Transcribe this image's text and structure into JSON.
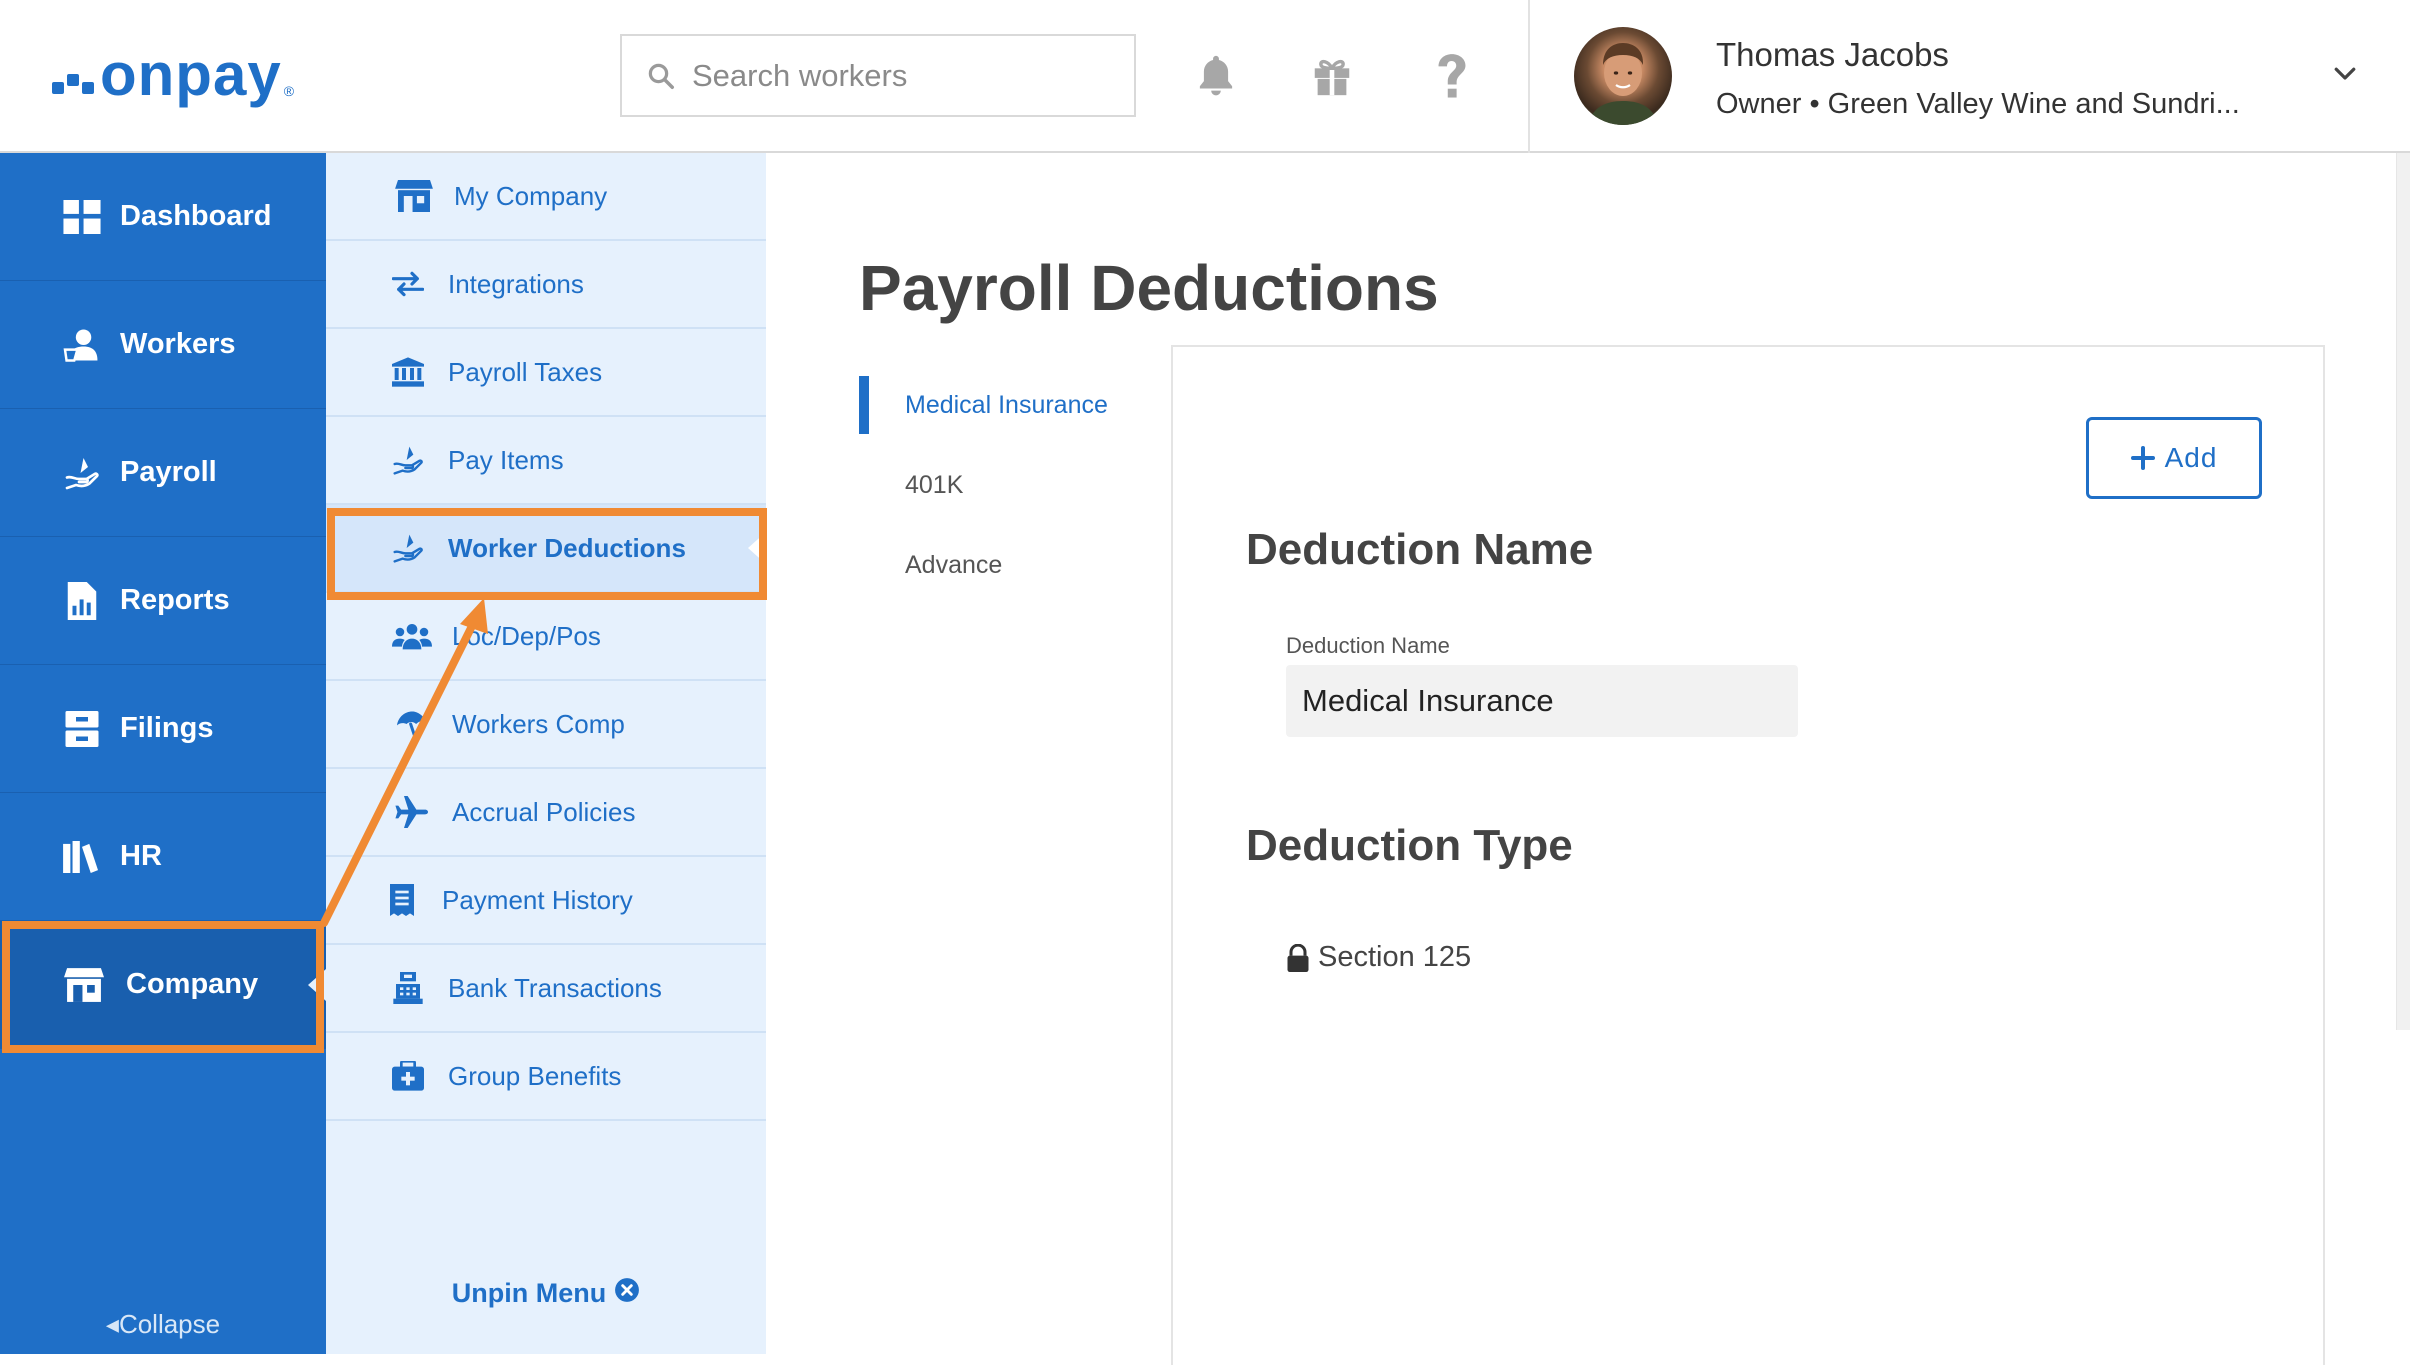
{
  "header": {
    "logo_text": "onpay",
    "logo_registered": "®",
    "search_placeholder": "Search workers",
    "icons": [
      "bell-icon",
      "gift-icon",
      "help-icon"
    ],
    "user": {
      "name": "Thomas Jacobs",
      "role": "Owner • Green Valley Wine and Sundri..."
    }
  },
  "sidebar": {
    "items": [
      {
        "label": "Dashboard",
        "icon": "dashboard-icon"
      },
      {
        "label": "Workers",
        "icon": "workers-icon"
      },
      {
        "label": "Payroll",
        "icon": "payroll-icon"
      },
      {
        "label": "Reports",
        "icon": "reports-icon"
      },
      {
        "label": "Filings",
        "icon": "filings-icon"
      },
      {
        "label": "HR",
        "icon": "hr-icon"
      },
      {
        "label": "Company",
        "icon": "company-icon",
        "active": true
      }
    ],
    "collapse_label": "Collapse"
  },
  "submenu": {
    "items": [
      {
        "label": "My Company",
        "icon": "store-icon"
      },
      {
        "label": "Integrations",
        "icon": "swap-icon"
      },
      {
        "label": "Payroll Taxes",
        "icon": "bank-icon"
      },
      {
        "label": "Pay Items",
        "icon": "hand-money-icon"
      },
      {
        "label": "Worker Deductions",
        "icon": "hand-money-icon",
        "active": true
      },
      {
        "label": "Loc/Dep/Pos",
        "icon": "people-group-icon"
      },
      {
        "label": "Workers Comp",
        "icon": "umbrella-icon"
      },
      {
        "label": "Accrual Policies",
        "icon": "plane-icon"
      },
      {
        "label": "Payment History",
        "icon": "receipt-icon"
      },
      {
        "label": "Bank Transactions",
        "icon": "register-icon"
      },
      {
        "label": "Group Benefits",
        "icon": "medical-kit-icon"
      }
    ],
    "unpin_label": "Unpin Menu"
  },
  "main": {
    "title": "Payroll Deductions",
    "deductions": [
      {
        "label": "Medical Insurance",
        "active": true
      },
      {
        "label": "401K"
      },
      {
        "label": "Advance"
      }
    ],
    "add_label": "Add",
    "section_name_title": "Deduction Name",
    "field_label": "Deduction Name",
    "field_value": "Medical Insurance",
    "section_type_title": "Deduction Type",
    "type_value": "Section 125"
  },
  "colors": {
    "brand_blue": "#1f6fc7",
    "submenu_bg": "#e6f1fd",
    "annotation_orange": "#f08a33"
  }
}
